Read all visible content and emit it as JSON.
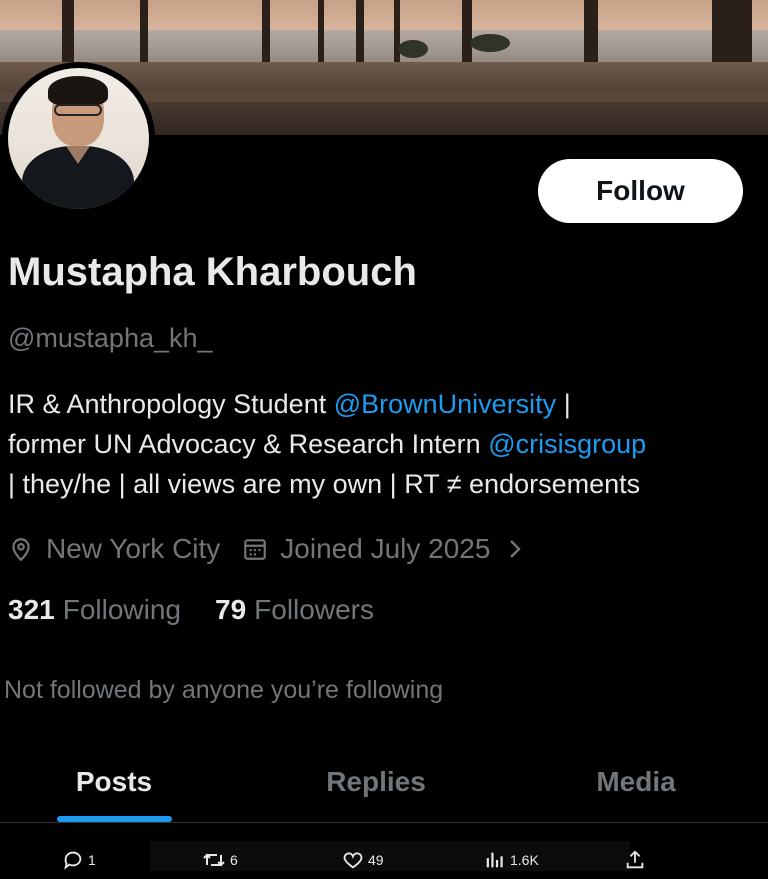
{
  "profile": {
    "name": "Mustapha Kharbouch",
    "handle": "@mustapha_kh_",
    "bio": {
      "line1_text": "IR & Anthropology Student ",
      "line1_link": "@BrownUniversity",
      "line1_tail": " |",
      "line2_text": "former UN Advocacy & Research Intern ",
      "line2_link": "@crisisgroup",
      "line3_text": "| they/he | all views are my own | RT ≠ endorsements"
    },
    "location": "New York City",
    "joined": "Joined July 2025",
    "following_count": "321",
    "following_label": "Following",
    "followers_count": "79",
    "followers_label": "Followers",
    "not_followed_text": "Not followed by anyone you’re following"
  },
  "follow_button": {
    "label": "Follow"
  },
  "tabs": [
    {
      "label": "Posts",
      "active": true
    },
    {
      "label": "Replies",
      "active": false
    },
    {
      "label": "Media",
      "active": false
    }
  ],
  "tweet_actions": {
    "reply_count": "1",
    "retweet_count": "6",
    "like_count": "49",
    "views_count": "1.6K"
  },
  "colors": {
    "accent": "#1d9bf0",
    "background": "#000000",
    "secondary_text": "#71767b",
    "primary_text": "#e7e9ea"
  },
  "icons": {
    "location": "map-pin-icon",
    "calendar": "calendar-icon",
    "chevron": "chevron-right-icon",
    "reply": "reply-icon",
    "retweet": "retweet-icon",
    "like": "heart-icon",
    "views": "views-icon",
    "share": "share-icon"
  }
}
